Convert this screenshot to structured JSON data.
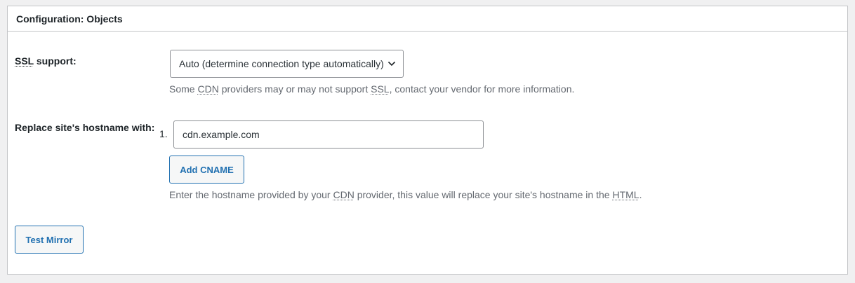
{
  "panel": {
    "title": "Configuration: Objects"
  },
  "ssl": {
    "label_abbr": "SSL",
    "label_rest": " support:",
    "selected": "Auto (determine connection type automatically)",
    "desc_1": "Some ",
    "desc_abbr_1": "CDN",
    "desc_2": " providers may or may not support ",
    "desc_abbr_2": "SSL",
    "desc_3": ", contact your vendor for more information."
  },
  "hostname": {
    "label": "Replace site's hostname with:",
    "item_number": "1.",
    "value": "cdn.example.com",
    "add_button": "Add CNAME",
    "desc_1": "Enter the hostname provided by your ",
    "desc_abbr_1": "CDN",
    "desc_2": " provider, this value will replace your site's hostname in the ",
    "desc_abbr_2": "HTML",
    "desc_3": "."
  },
  "test_button": "Test Mirror",
  "icons": {
    "dropdown": "chevron-down-icon"
  }
}
